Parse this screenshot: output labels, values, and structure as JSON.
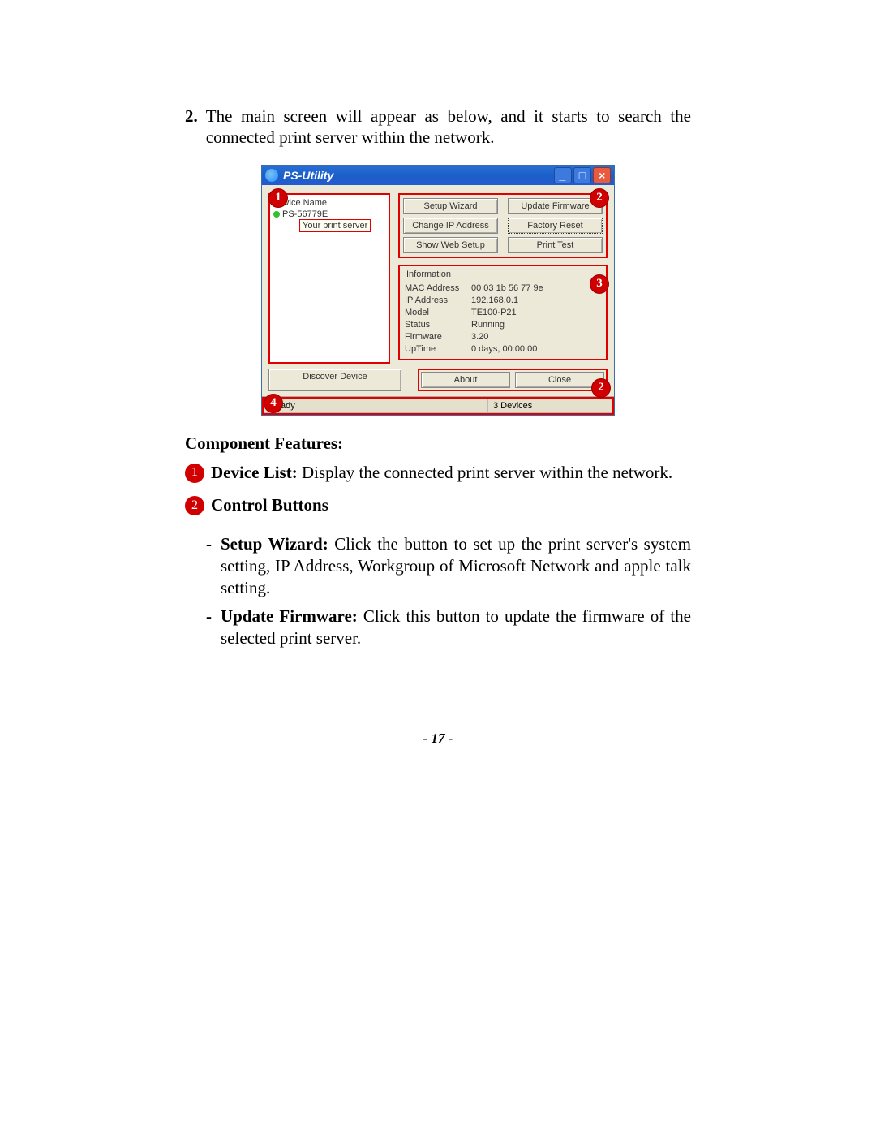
{
  "intro": {
    "number": "2.",
    "text": "The main screen will appear as below, and it starts to search the connected print server within the network."
  },
  "window": {
    "title": "PS-Utility",
    "device_list_header": "Device Name",
    "device_name": "PS-56779E",
    "tooltip": "Your print server",
    "buttons": {
      "setup_wizard": "Setup Wizard",
      "update_firmware": "Update Firmware",
      "change_ip": "Change IP Address",
      "factory_reset": "Factory Reset",
      "show_web": "Show Web Setup",
      "print_test": "Print Test",
      "discover": "Discover Device",
      "about": "About",
      "close": "Close"
    },
    "info": {
      "legend": "Information",
      "mac_label": "MAC Address",
      "mac": "00 03 1b 56 77 9e",
      "ip_label": "IP Address",
      "ip": "192.168.0.1",
      "model_label": "Model",
      "model": "TE100-P21",
      "status_label": "Status",
      "status": "Running",
      "firmware_label": "Firmware",
      "firmware": "3.20",
      "uptime_label": "UpTime",
      "uptime": "0 days, 00:00:00"
    },
    "status_ready": "Ready",
    "status_devices": "3 Devices"
  },
  "features": {
    "heading": "Component Features:",
    "item1_title": "Device List:",
    "item1_text": " Display the connected print server within the network.",
    "item2_title": "Control Buttons",
    "item2_sub1_title": "Setup Wizard:",
    "item2_sub1_text": " Click the button to set up the print server's system setting, IP Address, Workgroup of Microsoft Network and apple talk setting.",
    "item2_sub2_title": "Update Firmware:",
    "item2_sub2_text": " Click this button to update the firmware of the selected print server."
  },
  "page_number": "- 17 -",
  "callouts": {
    "c1": "1",
    "c2": "2",
    "c3": "3",
    "c4": "4"
  }
}
